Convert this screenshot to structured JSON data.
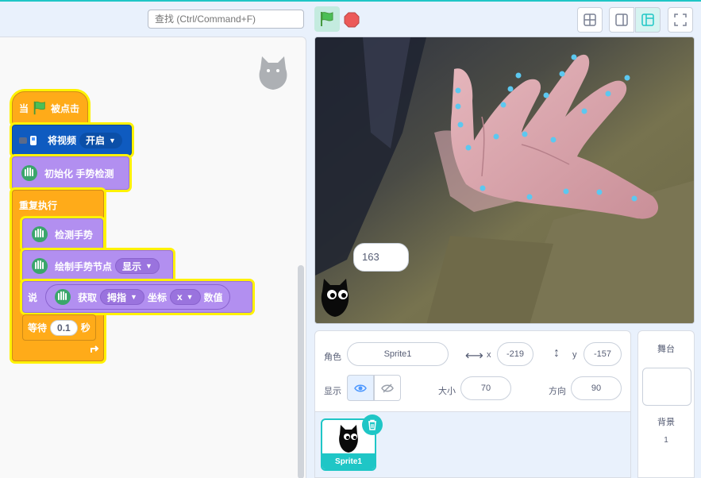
{
  "toolbar": {
    "search_placeholder": "查找 (Ctrl/Command+F)",
    "green_flag_icon": "green-flag-icon",
    "stop_icon": "stop-icon",
    "accent": "#1fc6c6"
  },
  "code": {
    "hat_prefix": "当",
    "hat_suffix": "被点击",
    "video_label": "将视频",
    "video_state": "开启",
    "init_label": "初始化 手势检测",
    "forever_label": "重复执行",
    "detect_label": "检测手势",
    "draw_label": "绘制手势节点",
    "draw_state": "显示",
    "say_label": "说",
    "get_label": "获取",
    "finger": "拇指",
    "coord_label": "坐标",
    "axis": "x",
    "value_label": "数值",
    "wait_label": "等待",
    "wait_value": "0.1",
    "seconds_label": "秒"
  },
  "stage": {
    "speech_text": "163",
    "landmark_color": "#5cc8f0"
  },
  "sprite_info": {
    "sprite_label": "角色",
    "sprite_name": "Sprite1",
    "x_label": "x",
    "x_value": "-219",
    "y_label": "y",
    "y_value": "-157",
    "show_label": "显示",
    "size_label": "大小",
    "size_value": "70",
    "direction_label": "方向",
    "direction_value": "90"
  },
  "sprite_list": {
    "items": [
      {
        "name": "Sprite1"
      }
    ]
  },
  "stage_panel": {
    "title": "舞台",
    "backdrop_label": "背景",
    "backdrop_count": "1"
  }
}
